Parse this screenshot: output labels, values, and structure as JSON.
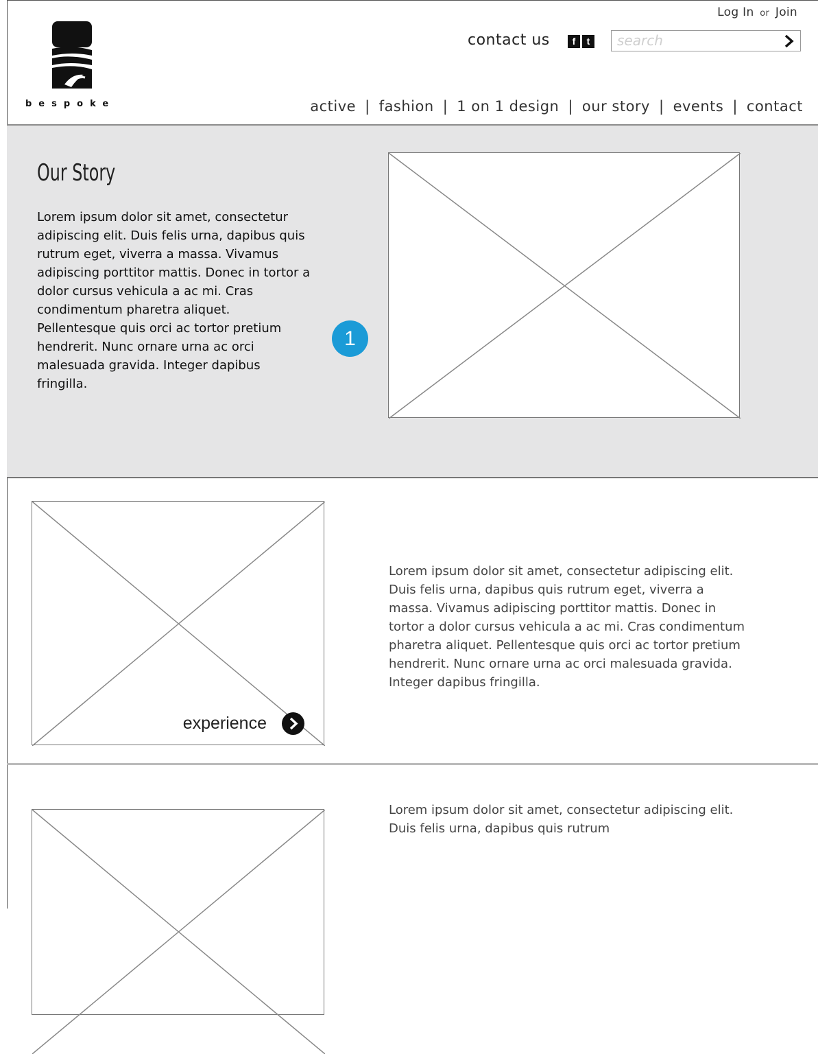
{
  "header": {
    "login": "Log In",
    "or": "or",
    "join": "Join",
    "brand": "bespoke",
    "contact_us": "contact us",
    "social": {
      "facebook": "f",
      "twitter": "t"
    },
    "search": {
      "placeholder": "search"
    },
    "nav": [
      "active",
      "fashion",
      "1 on 1 design",
      "our story",
      "events",
      "contact"
    ]
  },
  "hero": {
    "title": "Our Story",
    "text": "Lorem ipsum dolor sit amet, consectetur adipiscing elit. Duis felis urna, dapibus quis rutrum eget, viverra a massa. Vivamus adipiscing porttitor mattis. Donec in tortor a dolor cursus vehicula a ac mi. Cras condimentum pharetra aliquet. Pellentesque quis orci ac tortor pretium hendrerit. Nunc ornare urna ac orci malesuada gravida. Integer dapibus fringilla.",
    "badge": "1"
  },
  "sections": [
    {
      "text": "Lorem ipsum dolor sit amet, consectetur adipiscing elit. Duis felis urna, dapibus quis rutrum eget, viverra a massa. Vivamus adipiscing porttitor mattis. Donec in tortor a dolor cursus vehicula a ac mi. Cras condimentum pharetra aliquet. Pellentesque quis orci ac tortor pretium hendrerit. Nunc ornare urna ac orci malesuada gravida. Integer dapibus fringilla.",
      "cta": "experience"
    },
    {
      "text": "Lorem ipsum dolor sit amet, consectetur adipiscing elit. Duis felis urna, dapibus quis rutrum"
    }
  ],
  "colors": {
    "accent": "#1b9bd7",
    "hero_bg": "#e5e5e6"
  }
}
